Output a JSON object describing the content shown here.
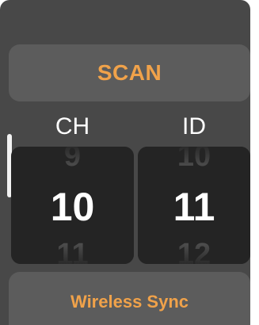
{
  "scan_button": {
    "label": "SCAN"
  },
  "columns": {
    "ch": {
      "label": "CH",
      "prev": "9",
      "current": "10",
      "next": "11"
    },
    "id": {
      "label": "ID",
      "prev": "10",
      "current": "11",
      "next": "12"
    }
  },
  "sync_button": {
    "label": "Wireless Sync"
  },
  "colors": {
    "background": "#484848",
    "button": "#5c5c5c",
    "wheel": "#242424",
    "accent": "#f0a24a",
    "text": "#ffffff",
    "dim_text": "#6d6d6d"
  }
}
